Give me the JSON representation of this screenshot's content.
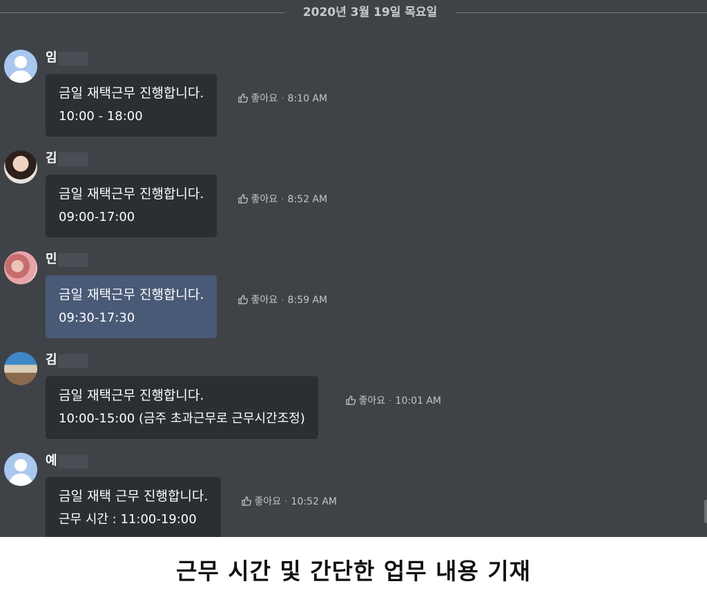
{
  "date_divider": "2020년 3월 19일 목요일",
  "like_label": "좋아요",
  "messages": [
    {
      "name": "임",
      "avatar": "default-user-icon",
      "line1": "금일 재택근무 진행합니다.",
      "line2": "10:00 - 18:00",
      "time": "8:10 AM",
      "highlighted": false
    },
    {
      "name": "김",
      "avatar": "profile-photo",
      "line1": "금일 재택근무 진행합니다.",
      "line2": "09:00-17:00",
      "time": "8:52 AM",
      "highlighted": false
    },
    {
      "name": "민",
      "avatar": "profile-photo",
      "line1": "금일 재택근무 진행합니다.",
      "line2": "09:30-17:30",
      "time": "8:59 AM",
      "highlighted": true
    },
    {
      "name": "김",
      "avatar": "profile-photo",
      "line1": "금일 재택근무 진행합니다.",
      "line2": "10:00-15:00 (금주 초과근무로 근무시간조정)",
      "time": "10:01 AM",
      "highlighted": false
    },
    {
      "name": "예",
      "avatar": "default-user-icon",
      "line1": "금일 재택 근무 진행합니다.",
      "line2": "근무 시간 : 11:00-19:00",
      "time": "10:52 AM",
      "highlighted": false
    }
  ],
  "caption": "근무 시간 및 간단한 업무 내용 기재",
  "colors": {
    "chat_background": "#3f4348",
    "bubble": "#2b2e33",
    "bubble_highlight": "#495a77",
    "default_avatar": "#a9c8ef"
  }
}
